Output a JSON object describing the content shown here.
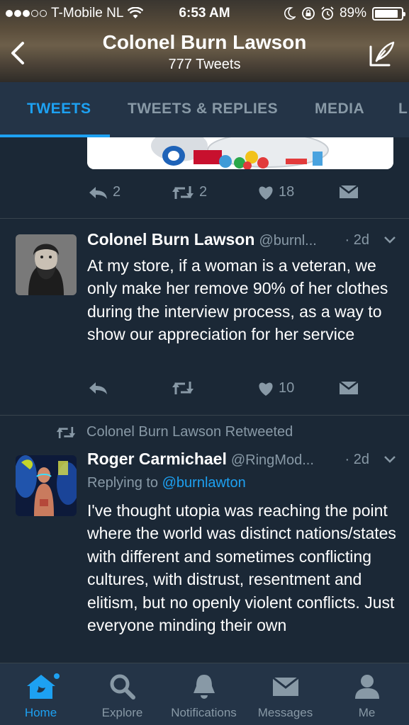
{
  "status_bar": {
    "carrier": "T-Mobile NL",
    "time": "6:53 AM",
    "battery": "89%",
    "battery_level": 0.89,
    "signal_bars": 3,
    "signal_total": 5
  },
  "header": {
    "title": "Colonel Burn Lawson",
    "tweet_count": "777 Tweets",
    "back_icon": "chevron-left-icon",
    "compose_icon": "compose-quill-icon"
  },
  "tabs": [
    {
      "label": "TWEETS",
      "active": true
    },
    {
      "label": "TWEETS & REPLIES",
      "active": false
    },
    {
      "label": "MEDIA",
      "active": false
    },
    {
      "label": "L",
      "active": false
    }
  ],
  "first_tweet_actions": {
    "reply_count": "2",
    "retweet_count": "2",
    "like_count": "18"
  },
  "tweets": [
    {
      "name": "Colonel Burn Lawson",
      "handle": "@burnl...",
      "time": "· 2d",
      "text": "At my store, if a woman is a veteran, we only make her remove 90% of her clothes during the interview process, as a way to show our appreciation for her service",
      "reply_count": "",
      "retweet_count": "",
      "like_count": "10"
    },
    {
      "retweeted_by": "Colonel Burn Lawson Retweeted",
      "name": "Roger Carmichael",
      "handle": "@RingMod...",
      "time": "· 2d",
      "replying_label": "Replying to",
      "replying_to": "@burnlawton",
      "text": "I've thought utopia was reaching the point where the world was distinct nations/states with different and sometimes conflicting cultures, with distrust, resentment and elitism, but no openly violent conflicts. Just everyone minding their own"
    }
  ],
  "bottom_nav": [
    {
      "label": "Home",
      "icon": "home-icon",
      "active": true
    },
    {
      "label": "Explore",
      "icon": "search-icon",
      "active": false
    },
    {
      "label": "Notifications",
      "icon": "bell-icon",
      "active": false
    },
    {
      "label": "Messages",
      "icon": "envelope-icon",
      "active": false
    },
    {
      "label": "Me",
      "icon": "person-icon",
      "active": false
    }
  ],
  "colors": {
    "accent": "#1da1f2",
    "background": "#1b2836",
    "bar": "#243447",
    "muted": "#8899a6"
  }
}
